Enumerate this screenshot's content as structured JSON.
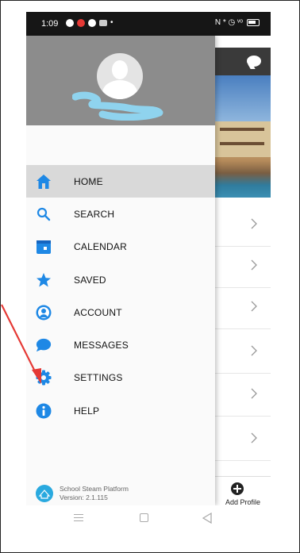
{
  "status_bar": {
    "time": "1:09",
    "right_text": "N * ◷ ᵛᵒ"
  },
  "drawer": {
    "menu": [
      {
        "label": "HOME",
        "icon": "home-icon",
        "active": true
      },
      {
        "label": "SEARCH",
        "icon": "search-icon",
        "active": false
      },
      {
        "label": "CALENDAR",
        "icon": "calendar-icon",
        "active": false
      },
      {
        "label": "SAVED",
        "icon": "star-icon",
        "active": false
      },
      {
        "label": "ACCOUNT",
        "icon": "account-icon",
        "active": false
      },
      {
        "label": "MESSAGES",
        "icon": "chat-bubble-icon",
        "active": false
      },
      {
        "label": "SETTINGS",
        "icon": "gear-icon",
        "active": false
      },
      {
        "label": "HELP",
        "icon": "info-icon",
        "active": false
      }
    ],
    "footer": {
      "platform": "School Steam Platform",
      "version": "Version: 2.1.115"
    }
  },
  "background_app": {
    "add_profile_label": "Add Profile"
  },
  "colors": {
    "accent": "#1e88e5",
    "header_gray": "#8c8c8c",
    "active_item": "#d9d9d9",
    "arrow": "#e53935"
  }
}
